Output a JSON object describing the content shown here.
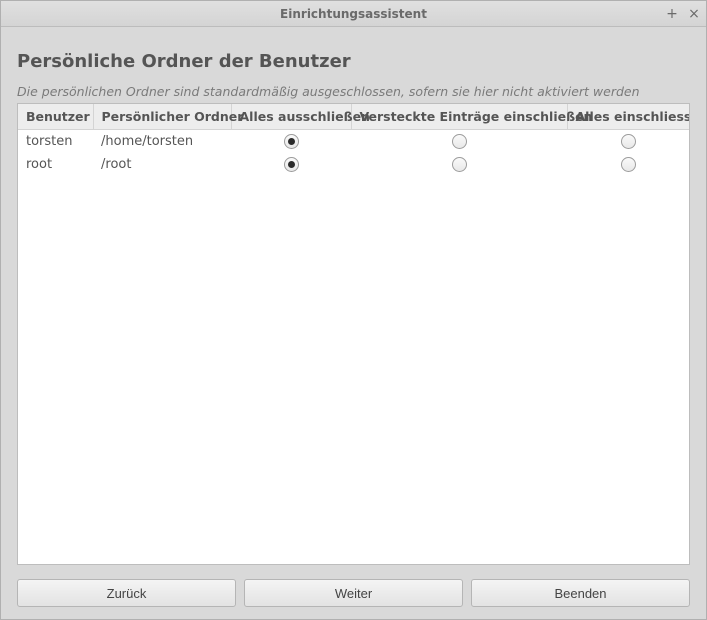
{
  "window": {
    "title": "Einrichtungsassistent"
  },
  "page": {
    "heading": "Persönliche Ordner der Benutzer",
    "description": "Die persönlichen Ordner sind standardmäßig ausgeschlossen, sofern sie hier nicht aktiviert werden"
  },
  "table": {
    "headers": {
      "user": "Benutzer",
      "folder": "Persönlicher Ordner",
      "exclude_all": "Alles ausschließen",
      "include_hidden": "Versteckte Einträge einschließen",
      "include_all": "Alles einschliessen"
    },
    "rows": [
      {
        "user": "torsten",
        "folder": "/home/torsten",
        "selection": "exclude_all"
      },
      {
        "user": "root",
        "folder": "/root",
        "selection": "exclude_all"
      }
    ]
  },
  "buttons": {
    "back": "Zurück",
    "next": "Weiter",
    "finish": "Beenden"
  }
}
